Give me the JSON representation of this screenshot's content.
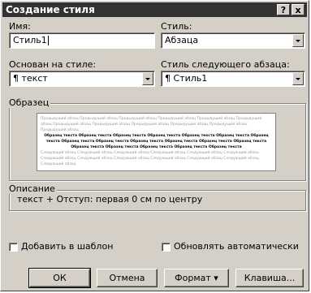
{
  "window": {
    "title": "Создание стиля",
    "help_symbol": "?",
    "close_symbol": "x"
  },
  "name_field": {
    "label": "Имя:",
    "value": "Стиль1"
  },
  "style_type": {
    "label": "Стиль:",
    "value": "Абзаца"
  },
  "based_on": {
    "label": "Основан на стиле:",
    "value": "¶ текст"
  },
  "next_style": {
    "label": "Стиль следующего абзаца:",
    "value": "¶ Стиль1"
  },
  "sample": {
    "label": "Образец",
    "prev_text": "Предыдущий абзац Предыдущий абзац Предыдущий абзац Предыдущий абзац Предыдущий абзац Предыдущий абзац Предыдущий абзац Предыдущий абзац Предыдущий абзац Предыдущий абзац Предыдущий абзац Предыдущий абзац",
    "sample_text": "Образец текста Образец текста Образец текста Образец текста Образец текста Образец текста Образец текста Образец текста Образец текста Образец текста Образец текста Образец текста Образец текста Образец текста Образец текста Образец текста Образец текста Образец текста",
    "next_text": "Следующий абзац Следующий абзац Следующий абзац Следующий абзац Следующий абзац Следующий абзац Следующий абзац Следующий абзац Следующий абзац Следующий абзац Следующий абзац Следующий абзац Следующий абзац"
  },
  "description": {
    "label": "Описание",
    "text": "текст + Отступ: первая 0 см по центру"
  },
  "checkboxes": {
    "add_to_template": "Добавить в шаблон",
    "auto_update": "Обновлять автоматически"
  },
  "buttons": {
    "ok": "ОК",
    "cancel": "Отмена",
    "format": "Формат ▾",
    "shortcut": "Клавиша..."
  },
  "colors": {
    "titlebar": "#333333",
    "face": "#d4d0c8"
  }
}
